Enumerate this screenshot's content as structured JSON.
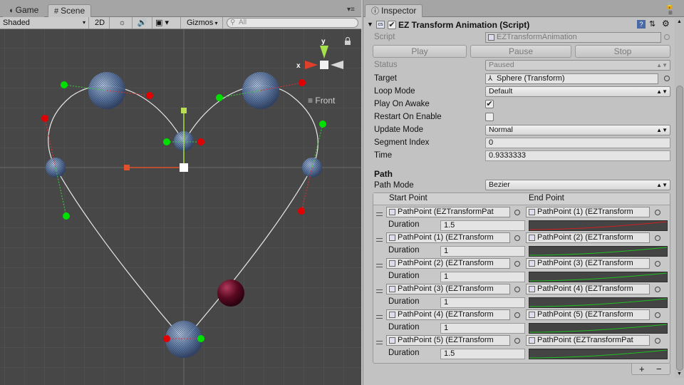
{
  "scene": {
    "tabs": [
      {
        "label": "Game",
        "icon": "pacman-game-icon"
      },
      {
        "label": "Scene",
        "icon": "grid-scene-icon"
      }
    ],
    "toolbar": {
      "shading": "Shaded",
      "mode_2d": "2D",
      "gizmos": "Gizmos",
      "search_placeholder": "All"
    },
    "gizmo_labels": {
      "x": "x",
      "y": "y"
    },
    "view_label": "Front"
  },
  "inspector": {
    "tab_label": "Inspector",
    "component_title": "EZ Transform Animation (Script)",
    "script_label": "Script",
    "script_value": "EZTransformAnimation",
    "buttons": {
      "play": "Play",
      "pause": "Pause",
      "stop": "Stop"
    },
    "fields": {
      "status_label": "Status",
      "status_value": "Paused",
      "target_label": "Target",
      "target_value": "Sphere (Transform)",
      "loop_mode_label": "Loop Mode",
      "loop_mode_value": "Default",
      "play_on_awake_label": "Play On Awake",
      "play_on_awake_checked": true,
      "restart_on_enable_label": "Restart On Enable",
      "restart_on_enable_checked": false,
      "update_mode_label": "Update Mode",
      "update_mode_value": "Normal",
      "segment_index_label": "Segment Index",
      "segment_index_value": "0",
      "time_label": "Time",
      "time_value": "0.9333333"
    },
    "path": {
      "section_title": "Path",
      "path_mode_label": "Path Mode",
      "path_mode_value": "Bezier",
      "start_header": "Start Point",
      "end_header": "End Point",
      "duration_label": "Duration",
      "segments": [
        {
          "start": "PathPoint (EZTransformPat",
          "end": "PathPoint (1) (EZTransform",
          "duration": "1.5",
          "curve_color": "#d02020"
        },
        {
          "start": "PathPoint (1) (EZTransform",
          "end": "PathPoint (2) (EZTransform",
          "duration": "1",
          "curve_color": "#20c020"
        },
        {
          "start": "PathPoint (2) (EZTransform",
          "end": "PathPoint (3) (EZTransform",
          "duration": "1",
          "curve_color": "#20c020"
        },
        {
          "start": "PathPoint (3) (EZTransform",
          "end": "PathPoint (4) (EZTransform",
          "duration": "1",
          "curve_color": "#20c020"
        },
        {
          "start": "PathPoint (4) (EZTransform",
          "end": "PathPoint (5) (EZTransform",
          "duration": "1",
          "curve_color": "#20c020"
        },
        {
          "start": "PathPoint (5) (EZTransform",
          "end": "PathPoint (EZTransformPat",
          "duration": "1.5",
          "curve_color": "#20c020"
        }
      ],
      "add_label": "+",
      "remove_label": "−"
    }
  }
}
